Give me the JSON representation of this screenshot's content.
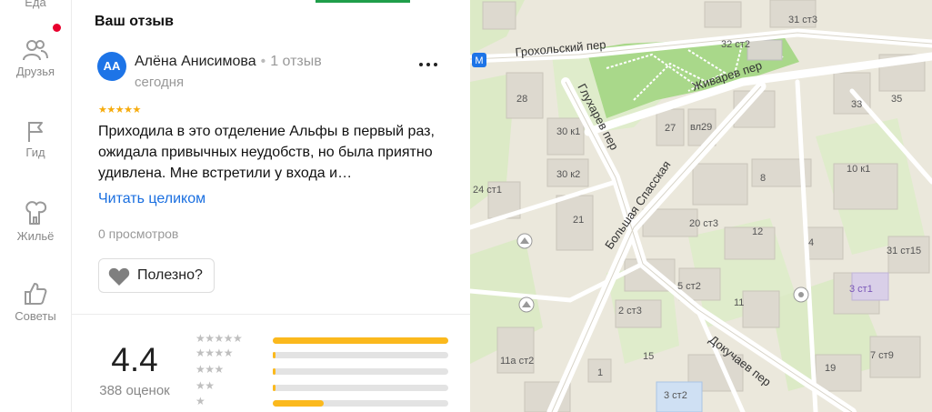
{
  "rail": {
    "top_stub": "Еда",
    "items": [
      {
        "label": "Друзья",
        "icon": "friends-icon"
      },
      {
        "label": "Гид",
        "icon": "flag-icon"
      },
      {
        "label": "Жильё",
        "icon": "housing-icon"
      },
      {
        "label": "Советы",
        "icon": "thumbs-up-icon"
      }
    ]
  },
  "review": {
    "section_title": "Ваш отзыв",
    "avatar_initials": "АА",
    "author_name": "Алёна Анисимова",
    "author_reviews": "1 отзыв",
    "date": "сегодня",
    "stars": 5,
    "text": "Приходила в это отделение Альфы в первый раз, ожидала привычных неудобств, но была приятно удивлена. Мне встретили у входа и…",
    "read_more": "Читать целиком",
    "views": "0 просмотров",
    "useful_label": "Полезно?"
  },
  "rating": {
    "value": "4.4",
    "count": "388 оценок",
    "distribution": [
      {
        "stars": 5,
        "fraction": 1.0
      },
      {
        "stars": 4,
        "fraction": 0.015
      },
      {
        "stars": 3,
        "fraction": 0.015
      },
      {
        "stars": 2,
        "fraction": 0.015
      },
      {
        "stars": 1,
        "fraction": 0.29
      }
    ]
  },
  "colors": {
    "accent_blue": "#1a6fe0",
    "star_yellow": "#f6ab0c",
    "bar_yellow": "#fbb91d",
    "notification_red": "#e8002d",
    "avatar_blue": "#1d74e7"
  },
  "map": {
    "streets": [
      "Грохольский пер",
      "Живарев пер",
      "Глухарев пер",
      "Большая Спасская",
      "Докучаев пер"
    ],
    "buildings": [
      "31 ст3",
      "32 ст2",
      "28",
      "30 к1",
      "27",
      "вл29",
      "33",
      "35",
      "30 к2",
      "8",
      "10 к1",
      "24 ст1",
      "21",
      "20 ст3",
      "12",
      "4",
      "31 ст15",
      "5 ст2",
      "3 ст1",
      "2 ст3",
      "11",
      "11а ст2",
      "1",
      "15",
      "3 ст2",
      "19",
      "7 ст9"
    ]
  }
}
